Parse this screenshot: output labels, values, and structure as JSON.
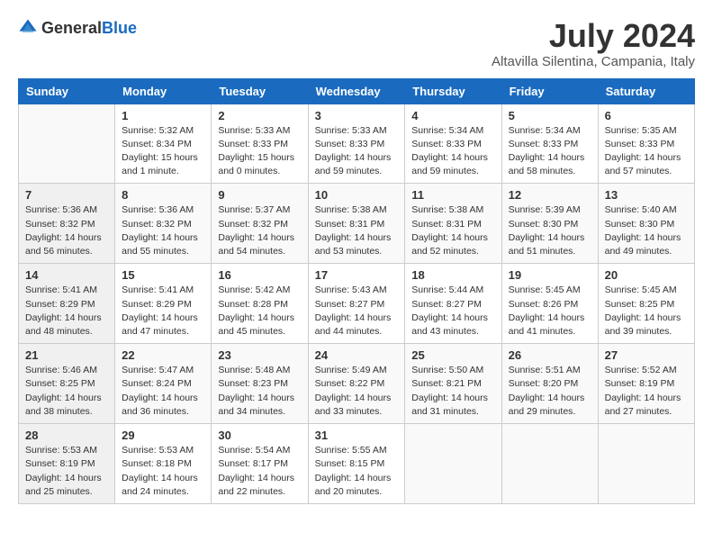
{
  "header": {
    "logo_general": "General",
    "logo_blue": "Blue",
    "month_title": "July 2024",
    "location": "Altavilla Silentina, Campania, Italy"
  },
  "columns": [
    "Sunday",
    "Monday",
    "Tuesday",
    "Wednesday",
    "Thursday",
    "Friday",
    "Saturday"
  ],
  "weeks": [
    [
      {
        "day": "",
        "info": ""
      },
      {
        "day": "1",
        "info": "Sunrise: 5:32 AM\nSunset: 8:34 PM\nDaylight: 15 hours\nand 1 minute."
      },
      {
        "day": "2",
        "info": "Sunrise: 5:33 AM\nSunset: 8:33 PM\nDaylight: 15 hours\nand 0 minutes."
      },
      {
        "day": "3",
        "info": "Sunrise: 5:33 AM\nSunset: 8:33 PM\nDaylight: 14 hours\nand 59 minutes."
      },
      {
        "day": "4",
        "info": "Sunrise: 5:34 AM\nSunset: 8:33 PM\nDaylight: 14 hours\nand 59 minutes."
      },
      {
        "day": "5",
        "info": "Sunrise: 5:34 AM\nSunset: 8:33 PM\nDaylight: 14 hours\nand 58 minutes."
      },
      {
        "day": "6",
        "info": "Sunrise: 5:35 AM\nSunset: 8:33 PM\nDaylight: 14 hours\nand 57 minutes."
      }
    ],
    [
      {
        "day": "7",
        "info": "Sunrise: 5:36 AM\nSunset: 8:32 PM\nDaylight: 14 hours\nand 56 minutes."
      },
      {
        "day": "8",
        "info": "Sunrise: 5:36 AM\nSunset: 8:32 PM\nDaylight: 14 hours\nand 55 minutes."
      },
      {
        "day": "9",
        "info": "Sunrise: 5:37 AM\nSunset: 8:32 PM\nDaylight: 14 hours\nand 54 minutes."
      },
      {
        "day": "10",
        "info": "Sunrise: 5:38 AM\nSunset: 8:31 PM\nDaylight: 14 hours\nand 53 minutes."
      },
      {
        "day": "11",
        "info": "Sunrise: 5:38 AM\nSunset: 8:31 PM\nDaylight: 14 hours\nand 52 minutes."
      },
      {
        "day": "12",
        "info": "Sunrise: 5:39 AM\nSunset: 8:30 PM\nDaylight: 14 hours\nand 51 minutes."
      },
      {
        "day": "13",
        "info": "Sunrise: 5:40 AM\nSunset: 8:30 PM\nDaylight: 14 hours\nand 49 minutes."
      }
    ],
    [
      {
        "day": "14",
        "info": "Sunrise: 5:41 AM\nSunset: 8:29 PM\nDaylight: 14 hours\nand 48 minutes."
      },
      {
        "day": "15",
        "info": "Sunrise: 5:41 AM\nSunset: 8:29 PM\nDaylight: 14 hours\nand 47 minutes."
      },
      {
        "day": "16",
        "info": "Sunrise: 5:42 AM\nSunset: 8:28 PM\nDaylight: 14 hours\nand 45 minutes."
      },
      {
        "day": "17",
        "info": "Sunrise: 5:43 AM\nSunset: 8:27 PM\nDaylight: 14 hours\nand 44 minutes."
      },
      {
        "day": "18",
        "info": "Sunrise: 5:44 AM\nSunset: 8:27 PM\nDaylight: 14 hours\nand 43 minutes."
      },
      {
        "day": "19",
        "info": "Sunrise: 5:45 AM\nSunset: 8:26 PM\nDaylight: 14 hours\nand 41 minutes."
      },
      {
        "day": "20",
        "info": "Sunrise: 5:45 AM\nSunset: 8:25 PM\nDaylight: 14 hours\nand 39 minutes."
      }
    ],
    [
      {
        "day": "21",
        "info": "Sunrise: 5:46 AM\nSunset: 8:25 PM\nDaylight: 14 hours\nand 38 minutes."
      },
      {
        "day": "22",
        "info": "Sunrise: 5:47 AM\nSunset: 8:24 PM\nDaylight: 14 hours\nand 36 minutes."
      },
      {
        "day": "23",
        "info": "Sunrise: 5:48 AM\nSunset: 8:23 PM\nDaylight: 14 hours\nand 34 minutes."
      },
      {
        "day": "24",
        "info": "Sunrise: 5:49 AM\nSunset: 8:22 PM\nDaylight: 14 hours\nand 33 minutes."
      },
      {
        "day": "25",
        "info": "Sunrise: 5:50 AM\nSunset: 8:21 PM\nDaylight: 14 hours\nand 31 minutes."
      },
      {
        "day": "26",
        "info": "Sunrise: 5:51 AM\nSunset: 8:20 PM\nDaylight: 14 hours\nand 29 minutes."
      },
      {
        "day": "27",
        "info": "Sunrise: 5:52 AM\nSunset: 8:19 PM\nDaylight: 14 hours\nand 27 minutes."
      }
    ],
    [
      {
        "day": "28",
        "info": "Sunrise: 5:53 AM\nSunset: 8:19 PM\nDaylight: 14 hours\nand 25 minutes."
      },
      {
        "day": "29",
        "info": "Sunrise: 5:53 AM\nSunset: 8:18 PM\nDaylight: 14 hours\nand 24 minutes."
      },
      {
        "day": "30",
        "info": "Sunrise: 5:54 AM\nSunset: 8:17 PM\nDaylight: 14 hours\nand 22 minutes."
      },
      {
        "day": "31",
        "info": "Sunrise: 5:55 AM\nSunset: 8:15 PM\nDaylight: 14 hours\nand 20 minutes."
      },
      {
        "day": "",
        "info": ""
      },
      {
        "day": "",
        "info": ""
      },
      {
        "day": "",
        "info": ""
      }
    ]
  ]
}
